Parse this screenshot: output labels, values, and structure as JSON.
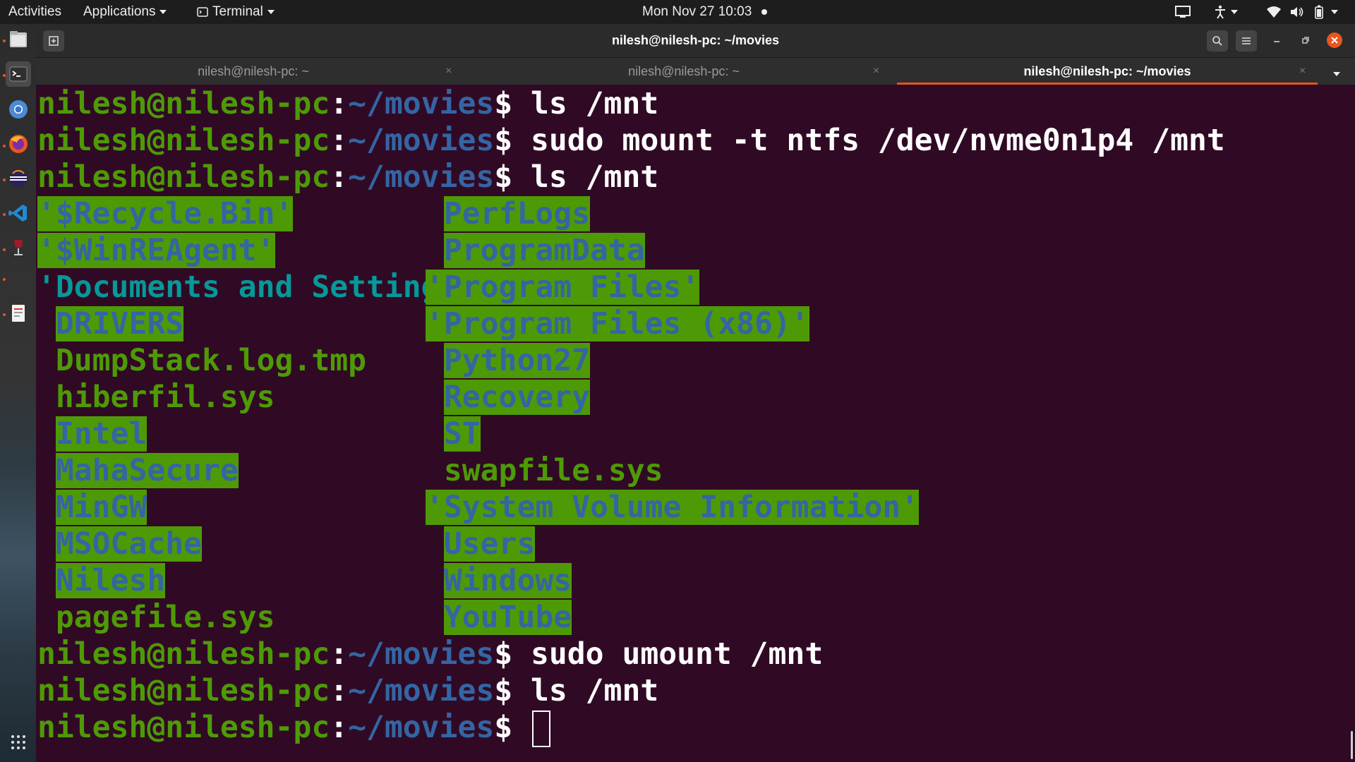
{
  "topbar": {
    "activities": "Activities",
    "applications": "Applications",
    "terminal_menu": "Terminal",
    "clock": "Mon Nov 27  10:03"
  },
  "dock": {
    "icons": [
      "files-icon",
      "terminal-icon",
      "chromium-icon",
      "firefox-icon",
      "eclipse-icon",
      "vscode-icon",
      "wine-icon",
      "text-editor-icon",
      "app-grid-icon"
    ]
  },
  "window": {
    "title": "nilesh@nilesh-pc: ~/movies",
    "tabs": [
      {
        "label": "nilesh@nilesh-pc: ~",
        "active": false
      },
      {
        "label": "nilesh@nilesh-pc: ~",
        "active": false
      },
      {
        "label": "nilesh@nilesh-pc: ~/movies",
        "active": true
      }
    ],
    "close_glyph": "×"
  },
  "colors": {
    "terminal_bg": "#300a24",
    "prompt_user": "#4e9a06",
    "prompt_path": "#3465a4",
    "accent": "#e95420"
  },
  "terminal": {
    "prompt_user": "nilesh@nilesh-pc",
    "prompt_sep": ":",
    "prompt_path": "~/movies",
    "prompt_dollar": "$ ",
    "commands": [
      "ls /mnt",
      "sudo mount -t ntfs /dev/nvme0n1p4 /mnt",
      "ls /mnt",
      "sudo umount /mnt",
      "ls /mnt",
      ""
    ],
    "listing_left": [
      {
        "text": "'$Recycle.Bin'",
        "style": "dirhl",
        "indent": ""
      },
      {
        "text": "'$WinREAgent'",
        "style": "dirhl",
        "indent": ""
      },
      {
        "text": "'Documents and Settings'",
        "style": "cyan",
        "indent": ""
      },
      {
        "text": "DRIVERS",
        "style": "dirhl",
        "indent": " "
      },
      {
        "text": "DumpStack.log.tmp",
        "style": "file",
        "indent": " "
      },
      {
        "text": "hiberfil.sys",
        "style": "file",
        "indent": " "
      },
      {
        "text": "Intel",
        "style": "dirhl",
        "indent": " "
      },
      {
        "text": "MahaSecure",
        "style": "dirhl",
        "indent": " "
      },
      {
        "text": "MinGW",
        "style": "dirhl",
        "indent": " "
      },
      {
        "text": "MSOCache",
        "style": "dirhl",
        "indent": " "
      },
      {
        "text": "Nilesh",
        "style": "dirhl",
        "indent": " "
      },
      {
        "text": "pagefile.sys",
        "style": "file",
        "indent": " "
      }
    ],
    "listing_right": [
      {
        "text": "PerfLogs",
        "style": "dirhl",
        "indent": " "
      },
      {
        "text": "ProgramData",
        "style": "dirhl",
        "indent": " "
      },
      {
        "text": "'Program Files'",
        "style": "dirhl",
        "indent": ""
      },
      {
        "text": "'Program Files (x86)'",
        "style": "dirhl",
        "indent": ""
      },
      {
        "text": "Python27",
        "style": "dirhl",
        "indent": " "
      },
      {
        "text": "Recovery",
        "style": "dirhl",
        "indent": " "
      },
      {
        "text": "ST",
        "style": "dirhl",
        "indent": " "
      },
      {
        "text": "swapfile.sys",
        "style": "file",
        "indent": " "
      },
      {
        "text": "'System Volume Information'",
        "style": "dirhl",
        "indent": ""
      },
      {
        "text": "Users",
        "style": "dirhl",
        "indent": " "
      },
      {
        "text": "Windows",
        "style": "dirhl",
        "indent": " "
      },
      {
        "text": "YouTube",
        "style": "dirhl",
        "indent": " "
      }
    ]
  }
}
